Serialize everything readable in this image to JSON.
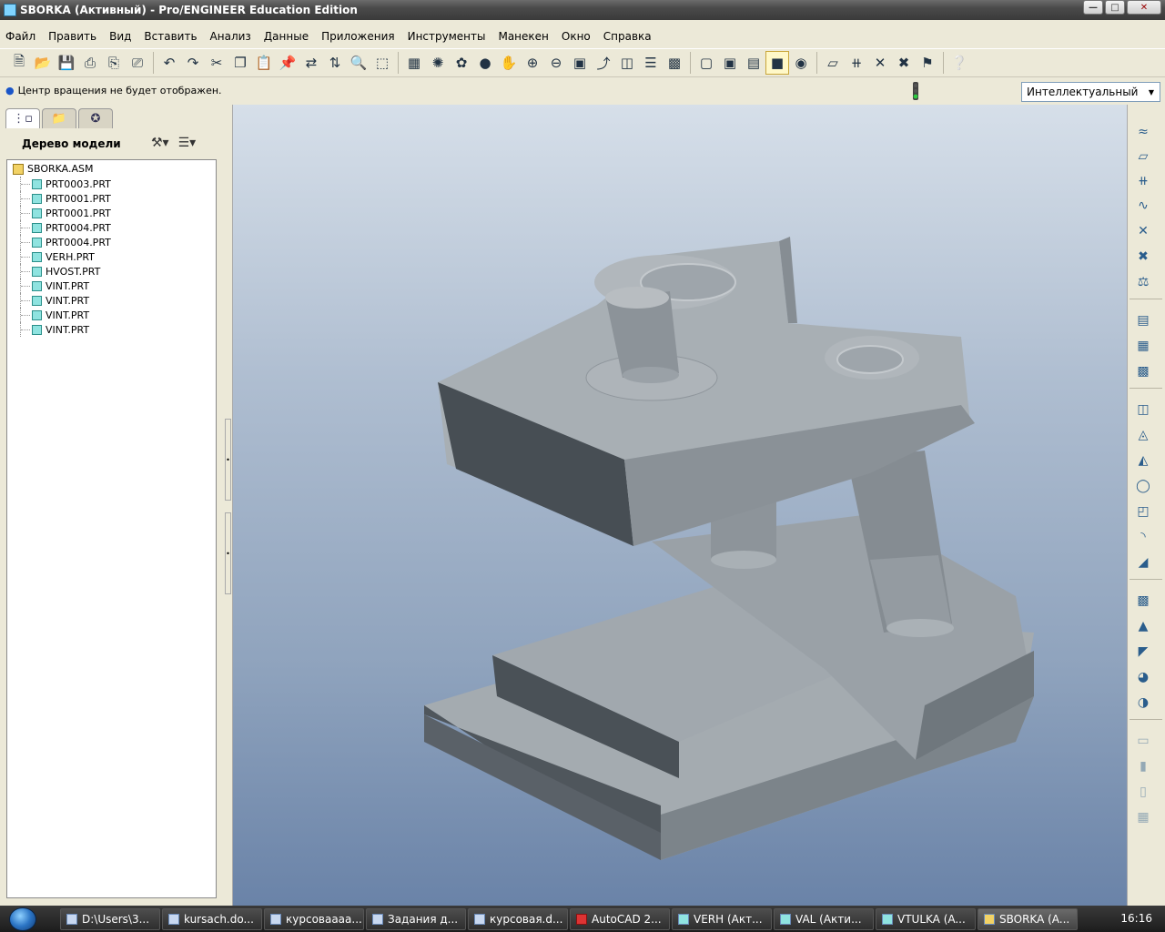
{
  "window": {
    "title": "SBORKA (Активный) - Pro/ENGINEER Education Edition"
  },
  "menu": [
    "Файл",
    "Править",
    "Вид",
    "Вставить",
    "Анализ",
    "Данные",
    "Приложения",
    "Инструменты",
    "Манекен",
    "Окно",
    "Справка"
  ],
  "status": {
    "message": "Центр вращения не будет отображен."
  },
  "filter": {
    "value": "Интеллектуальный"
  },
  "model_tree": {
    "header": "Дерево модели",
    "root": "SBORKA.ASM",
    "items": [
      "PRT0003.PRT",
      "PRT0001.PRT",
      "PRT0001.PRT",
      "PRT0004.PRT",
      "PRT0004.PRT",
      "VERH.PRT",
      "HVOST.PRT",
      "VINT.PRT",
      "VINT.PRT",
      "VINT.PRT",
      "VINT.PRT"
    ]
  },
  "taskbar": {
    "tasks": [
      "D:\\Users\\3...",
      "kursach.do...",
      "курсоваааа...",
      "Задания д...",
      "курсовая.d...",
      "AutoCAD 2...",
      "VERH (Акт...",
      "VAL (Акти...",
      "VTULKA (A...",
      "SBORKA (A..."
    ],
    "clock": "16:16"
  },
  "colors": {
    "viewport_top": "#d6dfe9",
    "viewport_bottom": "#6a83a8",
    "part_gray": "#a6adb2"
  }
}
